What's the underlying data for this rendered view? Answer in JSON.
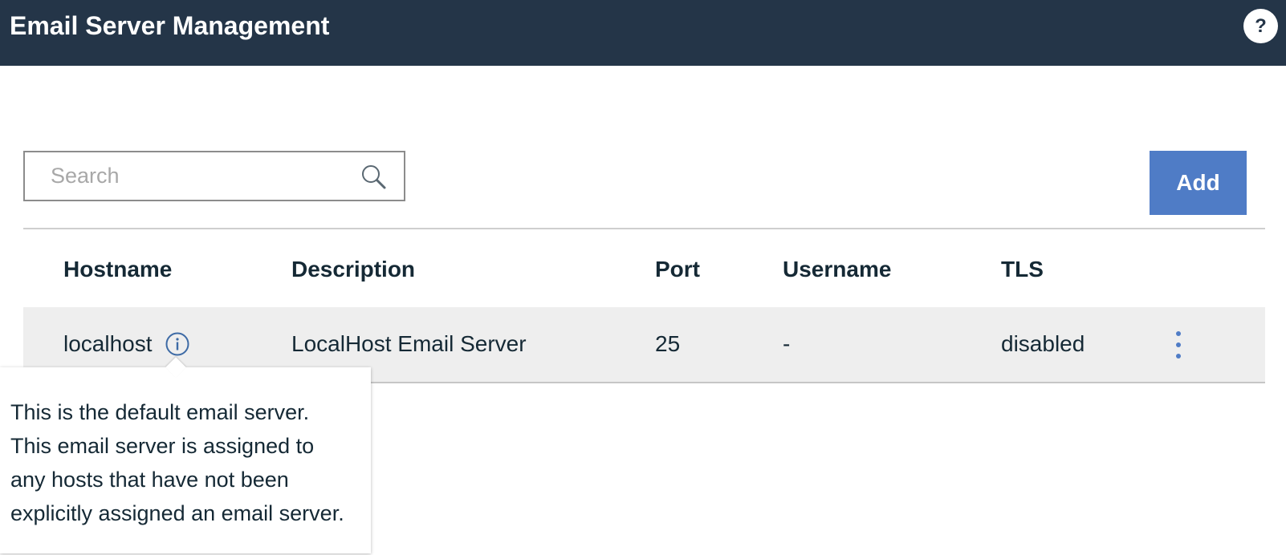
{
  "header": {
    "title": "Email Server Management",
    "help_label": "?"
  },
  "toolbar": {
    "search_placeholder": "Search",
    "add_label": "Add"
  },
  "table": {
    "columns": [
      "Hostname",
      "Description",
      "Port",
      "Username",
      "TLS"
    ],
    "rows": [
      {
        "hostname": "localhost",
        "description": "LocalHost Email Server",
        "port": "25",
        "username": "-",
        "tls": "disabled"
      }
    ]
  },
  "tooltip": {
    "lines": [
      "This is the default email server.",
      "This email server is assigned to",
      "any hosts that have not been",
      "explicitly assigned an email server."
    ]
  },
  "colors": {
    "header_bg": "#243548",
    "accent": "#4f7cc6",
    "row_bg": "#eeeeee"
  },
  "icons": [
    "help-icon",
    "search-icon",
    "info-icon",
    "overflow-menu-icon"
  ]
}
